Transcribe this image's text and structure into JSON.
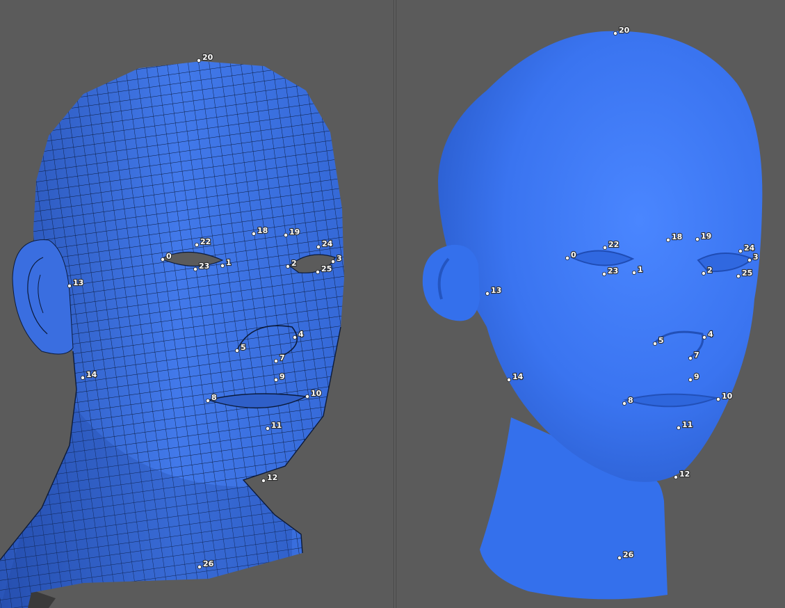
{
  "colors": {
    "background": "#5b5b5b",
    "mesh_fill": "#3c6fe0",
    "smooth_fill": "#3a75f2",
    "wire": "#0b1a3a",
    "landmark": "#ffffff"
  },
  "viewports": [
    {
      "id": "left",
      "mode": "wireframe-mesh"
    },
    {
      "id": "right",
      "mode": "smooth-shaded"
    }
  ],
  "landmarks": {
    "left": [
      {
        "id": "0",
        "label": "0"
      },
      {
        "id": "1",
        "label": "1"
      },
      {
        "id": "2",
        "label": "2"
      },
      {
        "id": "3",
        "label": "3"
      },
      {
        "id": "4",
        "label": "4"
      },
      {
        "id": "5",
        "label": "5"
      },
      {
        "id": "7",
        "label": "7"
      },
      {
        "id": "8",
        "label": "8"
      },
      {
        "id": "9",
        "label": "9"
      },
      {
        "id": "10",
        "label": "10"
      },
      {
        "id": "11",
        "label": "11"
      },
      {
        "id": "12",
        "label": "12"
      },
      {
        "id": "13",
        "label": "13"
      },
      {
        "id": "14",
        "label": "14"
      },
      {
        "id": "18",
        "label": "18"
      },
      {
        "id": "19",
        "label": "19"
      },
      {
        "id": "20",
        "label": "20"
      },
      {
        "id": "22",
        "label": "22"
      },
      {
        "id": "23",
        "label": "23"
      },
      {
        "id": "24",
        "label": "24"
      },
      {
        "id": "25",
        "label": "25"
      },
      {
        "id": "26",
        "label": "26"
      }
    ],
    "right": [
      {
        "id": "0",
        "label": "0"
      },
      {
        "id": "1",
        "label": "1"
      },
      {
        "id": "2",
        "label": "2"
      },
      {
        "id": "3",
        "label": "3"
      },
      {
        "id": "4",
        "label": "4"
      },
      {
        "id": "5",
        "label": "5"
      },
      {
        "id": "7",
        "label": "7"
      },
      {
        "id": "8",
        "label": "8"
      },
      {
        "id": "9",
        "label": "9"
      },
      {
        "id": "10",
        "label": "10"
      },
      {
        "id": "11",
        "label": "11"
      },
      {
        "id": "12",
        "label": "12"
      },
      {
        "id": "13",
        "label": "13"
      },
      {
        "id": "14",
        "label": "14"
      },
      {
        "id": "18",
        "label": "18"
      },
      {
        "id": "19",
        "label": "19"
      },
      {
        "id": "20",
        "label": "20"
      },
      {
        "id": "22",
        "label": "22"
      },
      {
        "id": "23",
        "label": "23"
      },
      {
        "id": "24",
        "label": "24"
      },
      {
        "id": "25",
        "label": "25"
      },
      {
        "id": "26",
        "label": "26"
      }
    ]
  }
}
